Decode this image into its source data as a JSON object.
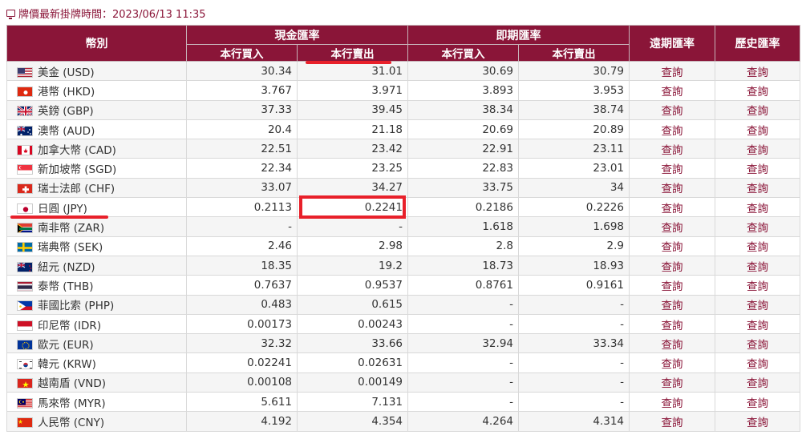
{
  "header": {
    "label": "牌價最新掛牌時間：2023/06/13 11:35"
  },
  "columns": {
    "currency": "幣別",
    "cash": "現金匯率",
    "spot": "即期匯率",
    "forward": "遠期匯率",
    "history": "歷史匯率",
    "buy": "本行買入",
    "sell": "本行賣出"
  },
  "colors": {
    "header_bg": "#8a1538",
    "highlight": "#e8202a"
  },
  "rows": [
    {
      "name": "美金 (USD)",
      "flag": "us-flag-icon",
      "cash_buy": "30.34",
      "cash_sell": "31.01",
      "spot_buy": "30.69",
      "spot_sell": "30.79",
      "forward": "查詢",
      "history": "查詢"
    },
    {
      "name": "港幣 (HKD)",
      "flag": "hk-flag-icon",
      "cash_buy": "3.767",
      "cash_sell": "3.971",
      "spot_buy": "3.893",
      "spot_sell": "3.953",
      "forward": "查詢",
      "history": "查詢"
    },
    {
      "name": "英鎊 (GBP)",
      "flag": "gb-flag-icon",
      "cash_buy": "37.33",
      "cash_sell": "39.45",
      "spot_buy": "38.34",
      "spot_sell": "38.74",
      "forward": "查詢",
      "history": "查詢"
    },
    {
      "name": "澳幣 (AUD)",
      "flag": "au-flag-icon",
      "cash_buy": "20.4",
      "cash_sell": "21.18",
      "spot_buy": "20.69",
      "spot_sell": "20.89",
      "forward": "查詢",
      "history": "查詢"
    },
    {
      "name": "加拿大幣 (CAD)",
      "flag": "ca-flag-icon",
      "cash_buy": "22.51",
      "cash_sell": "23.42",
      "spot_buy": "22.91",
      "spot_sell": "23.11",
      "forward": "查詢",
      "history": "查詢"
    },
    {
      "name": "新加坡幣 (SGD)",
      "flag": "sg-flag-icon",
      "cash_buy": "22.34",
      "cash_sell": "23.25",
      "spot_buy": "22.83",
      "spot_sell": "23.01",
      "forward": "查詢",
      "history": "查詢"
    },
    {
      "name": "瑞士法郎 (CHF)",
      "flag": "ch-flag-icon",
      "cash_buy": "33.07",
      "cash_sell": "34.27",
      "spot_buy": "33.75",
      "spot_sell": "34",
      "forward": "查詢",
      "history": "查詢"
    },
    {
      "name": "日圓 (JPY)",
      "flag": "jp-flag-icon",
      "cash_buy": "0.2113",
      "cash_sell": "0.2241",
      "spot_buy": "0.2186",
      "spot_sell": "0.2226",
      "forward": "查詢",
      "history": "查詢"
    },
    {
      "name": "南非幣 (ZAR)",
      "flag": "za-flag-icon",
      "cash_buy": "-",
      "cash_sell": "-",
      "spot_buy": "1.618",
      "spot_sell": "1.698",
      "forward": "查詢",
      "history": "查詢"
    },
    {
      "name": "瑞典幣 (SEK)",
      "flag": "se-flag-icon",
      "cash_buy": "2.46",
      "cash_sell": "2.98",
      "spot_buy": "2.8",
      "spot_sell": "2.9",
      "forward": "查詢",
      "history": "查詢"
    },
    {
      "name": "紐元 (NZD)",
      "flag": "nz-flag-icon",
      "cash_buy": "18.35",
      "cash_sell": "19.2",
      "spot_buy": "18.73",
      "spot_sell": "18.93",
      "forward": "查詢",
      "history": "查詢"
    },
    {
      "name": "泰幣 (THB)",
      "flag": "th-flag-icon",
      "cash_buy": "0.7637",
      "cash_sell": "0.9537",
      "spot_buy": "0.8761",
      "spot_sell": "0.9161",
      "forward": "查詢",
      "history": "查詢"
    },
    {
      "name": "菲國比索 (PHP)",
      "flag": "ph-flag-icon",
      "cash_buy": "0.483",
      "cash_sell": "0.615",
      "spot_buy": "-",
      "spot_sell": "-",
      "forward": "查詢",
      "history": "查詢"
    },
    {
      "name": "印尼幣 (IDR)",
      "flag": "id-flag-icon",
      "cash_buy": "0.00173",
      "cash_sell": "0.00243",
      "spot_buy": "-",
      "spot_sell": "-",
      "forward": "查詢",
      "history": "查詢"
    },
    {
      "name": "歐元 (EUR)",
      "flag": "eu-flag-icon",
      "cash_buy": "32.32",
      "cash_sell": "33.66",
      "spot_buy": "32.94",
      "spot_sell": "33.34",
      "forward": "查詢",
      "history": "查詢"
    },
    {
      "name": "韓元 (KRW)",
      "flag": "kr-flag-icon",
      "cash_buy": "0.02241",
      "cash_sell": "0.02631",
      "spot_buy": "-",
      "spot_sell": "-",
      "forward": "查詢",
      "history": "查詢"
    },
    {
      "name": "越南盾 (VND)",
      "flag": "vn-flag-icon",
      "cash_buy": "0.00108",
      "cash_sell": "0.00149",
      "spot_buy": "-",
      "spot_sell": "-",
      "forward": "查詢",
      "history": "查詢"
    },
    {
      "name": "馬來幣 (MYR)",
      "flag": "my-flag-icon",
      "cash_buy": "5.611",
      "cash_sell": "7.131",
      "spot_buy": "-",
      "spot_sell": "-",
      "forward": "查詢",
      "history": "查詢"
    },
    {
      "name": "人民幣 (CNY)",
      "flag": "cn-flag-icon",
      "cash_buy": "4.192",
      "cash_sell": "4.354",
      "spot_buy": "4.264",
      "spot_sell": "4.314",
      "forward": "查詢",
      "history": "查詢"
    }
  ]
}
